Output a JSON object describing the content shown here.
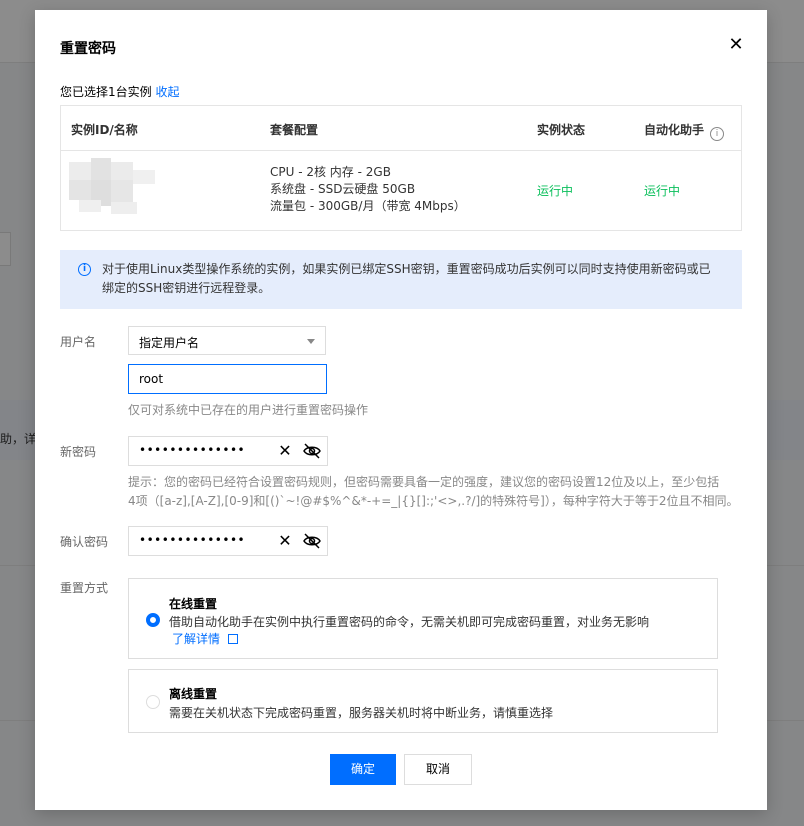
{
  "background": {
    "partial_text": "助，详"
  },
  "modal": {
    "title": "重置密码",
    "selected_prefix": "您已选择1台实例",
    "collapse_link": "收起",
    "table": {
      "headers": [
        "实例ID/名称",
        "套餐配置",
        "实例状态",
        "自动化助手"
      ],
      "rows": [
        {
          "spec_lines": [
            "CPU - 2核 内存 - 2GB",
            "系统盘 - SSD云硬盘 50GB",
            "流量包 - 300GB/月（带宽 4Mbps）"
          ],
          "status": "运行中",
          "assistant_status": "运行中"
        }
      ]
    },
    "notice": "对于使用Linux类型操作系统的实例，如果实例已绑定SSH密钥，重置密码成功后实例可以同时支持使用新密码或已绑定的SSH密钥进行远程登录。",
    "username": {
      "label": "用户名",
      "select_value": "指定用户名",
      "input_value": "root",
      "hint": "仅可对系统中已存在的用户进行重置密码操作"
    },
    "new_password": {
      "label": "新密码",
      "masked_value": "••••••••••••••",
      "hint_line1": "提示：您的密码已经符合设置密码规则，但密码需要具备一定的强度，建议您的密码设置12位及以上，至少包括",
      "hint_line2": "4项（[a-z],[A-Z],[0-9]和[()`~!@#$%^&*-+=_|{}[]:;'<>,.?/]的特殊符号]），每种字符大于等于2位且不相同。"
    },
    "confirm_password": {
      "label": "确认密码",
      "masked_value": "••••••••••••••"
    },
    "reset_method": {
      "label": "重置方式",
      "online": {
        "title": "在线重置",
        "desc": "借助自动化助手在实例中执行重置密码的命令，无需关机即可完成密码重置，对业务无影响",
        "link": "了解详情"
      },
      "offline": {
        "title": "离线重置",
        "desc": "需要在关机状态下完成密码重置，服务器关机时将中断业务，请慎重选择"
      }
    },
    "buttons": {
      "confirm": "确定",
      "cancel": "取消"
    }
  },
  "colors": {
    "primary": "#006eff",
    "success": "#0abf5b",
    "notice_bg": "#e5edfc"
  },
  "icons": {
    "close": "close-icon",
    "info": "info-icon",
    "clear": "clear-icon",
    "visibility": "eye-off-icon",
    "external": "external-link-icon"
  }
}
